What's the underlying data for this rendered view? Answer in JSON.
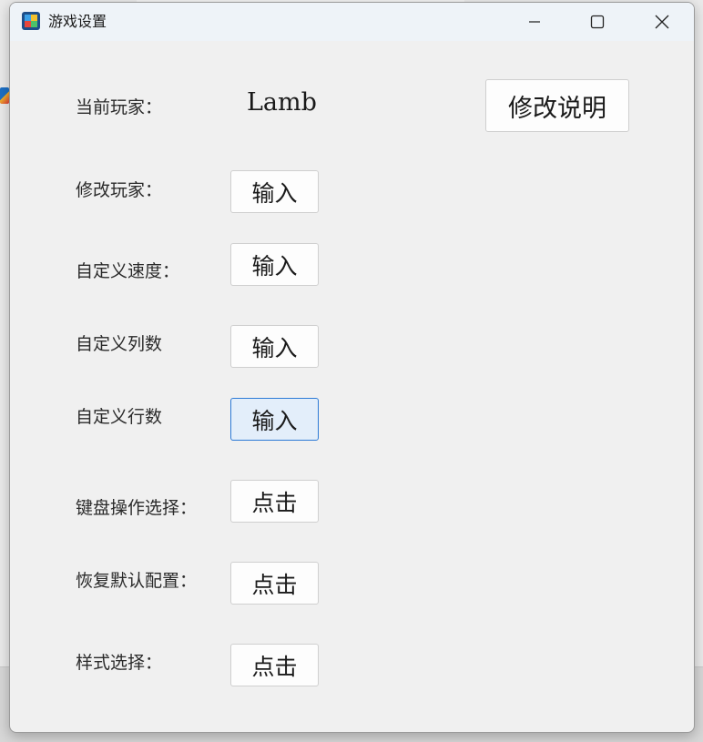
{
  "window": {
    "title": "游戏设置"
  },
  "controls": {
    "minimize_icon": "minimize-icon",
    "maximize_icon": "maximize-icon",
    "close_icon": "close-icon"
  },
  "current_player": {
    "label": "当前玩家：",
    "value": "Lamb"
  },
  "help_button": "修改说明",
  "rows": [
    {
      "label": "修改玩家：",
      "button": "输入"
    },
    {
      "label": "自定义速度：",
      "button": "输入"
    },
    {
      "label": "自定义列数",
      "button": "输入"
    },
    {
      "label": "自定义行数",
      "button": "输入"
    },
    {
      "label": "键盘操作选择：",
      "button": "点击"
    },
    {
      "label": "恢复默认配置：",
      "button": "点击"
    },
    {
      "label": "样式选择：",
      "button": "点击"
    }
  ]
}
